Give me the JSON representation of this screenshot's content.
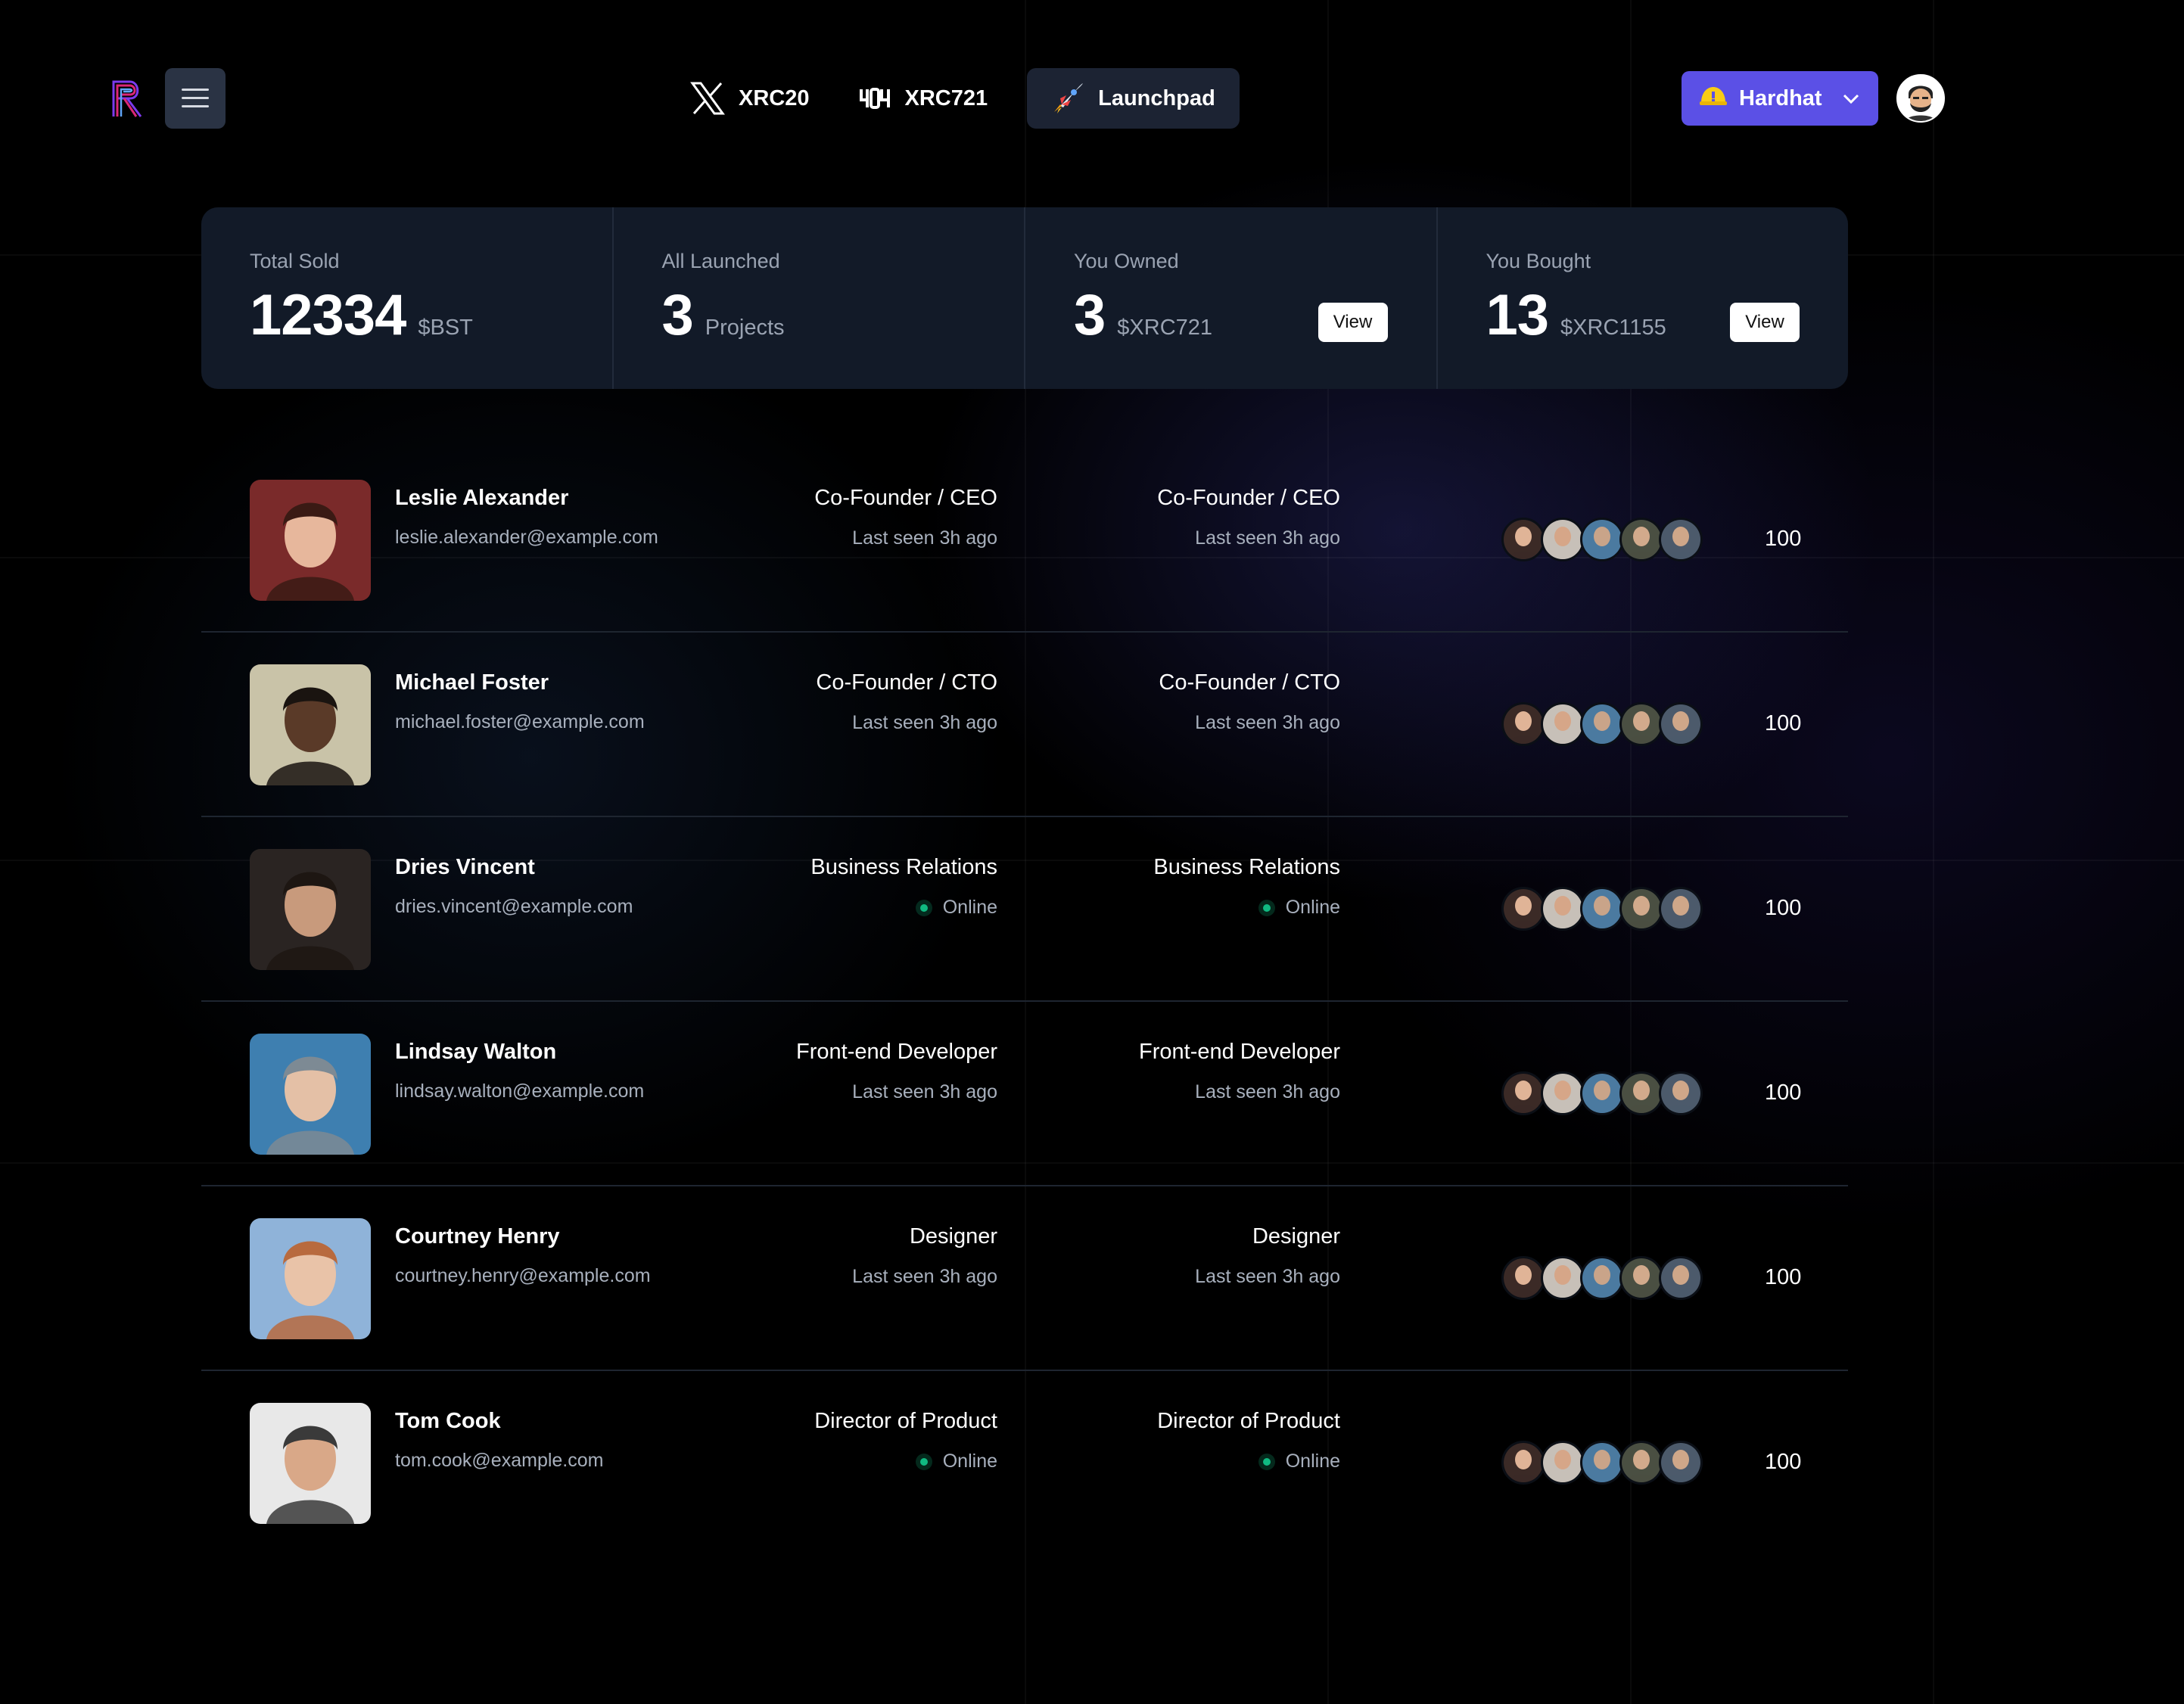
{
  "header": {
    "nav": [
      {
        "label": "XRC20",
        "icon": "x-logo-icon"
      },
      {
        "label": "XRC721",
        "icon": "404-icon"
      },
      {
        "label": "Launchpad",
        "icon": "rocket-icon",
        "active": true
      }
    ],
    "network": {
      "label": "Hardhat",
      "icon": "hardhat-icon",
      "color": "#5b50e6"
    }
  },
  "stats": [
    {
      "label": "Total Sold",
      "value": "12334",
      "unit": "$BST"
    },
    {
      "label": "All Launched",
      "value": "3",
      "unit": "Projects"
    },
    {
      "label": "You Owned",
      "value": "3",
      "unit": "$XRC721",
      "action": "View"
    },
    {
      "label": "You Bought",
      "value": "13",
      "unit": "$XRC1155",
      "action": "View"
    }
  ],
  "people": [
    {
      "name": "Leslie Alexander",
      "email": "leslie.alexander@example.com",
      "role": "Co-Founder / CEO",
      "status": "Last seen 3h ago",
      "online": false,
      "count": "100"
    },
    {
      "name": "Michael Foster",
      "email": "michael.foster@example.com",
      "role": "Co-Founder / CTO",
      "status": "Last seen 3h ago",
      "online": false,
      "count": "100"
    },
    {
      "name": "Dries Vincent",
      "email": "dries.vincent@example.com",
      "role": "Business Relations",
      "status": "Online",
      "online": true,
      "count": "100"
    },
    {
      "name": "Lindsay Walton",
      "email": "lindsay.walton@example.com",
      "role": "Front-end Developer",
      "status": "Last seen 3h ago",
      "online": false,
      "count": "100"
    },
    {
      "name": "Courtney Henry",
      "email": "courtney.henry@example.com",
      "role": "Designer",
      "status": "Last seen 3h ago",
      "online": false,
      "count": "100"
    },
    {
      "name": "Tom Cook",
      "email": "tom.cook@example.com",
      "role": "Director of Product",
      "status": "Online",
      "online": true,
      "count": "100"
    }
  ],
  "colors": {
    "accent": "#5b50e6",
    "online": "#10b981",
    "card": "#121a28"
  }
}
